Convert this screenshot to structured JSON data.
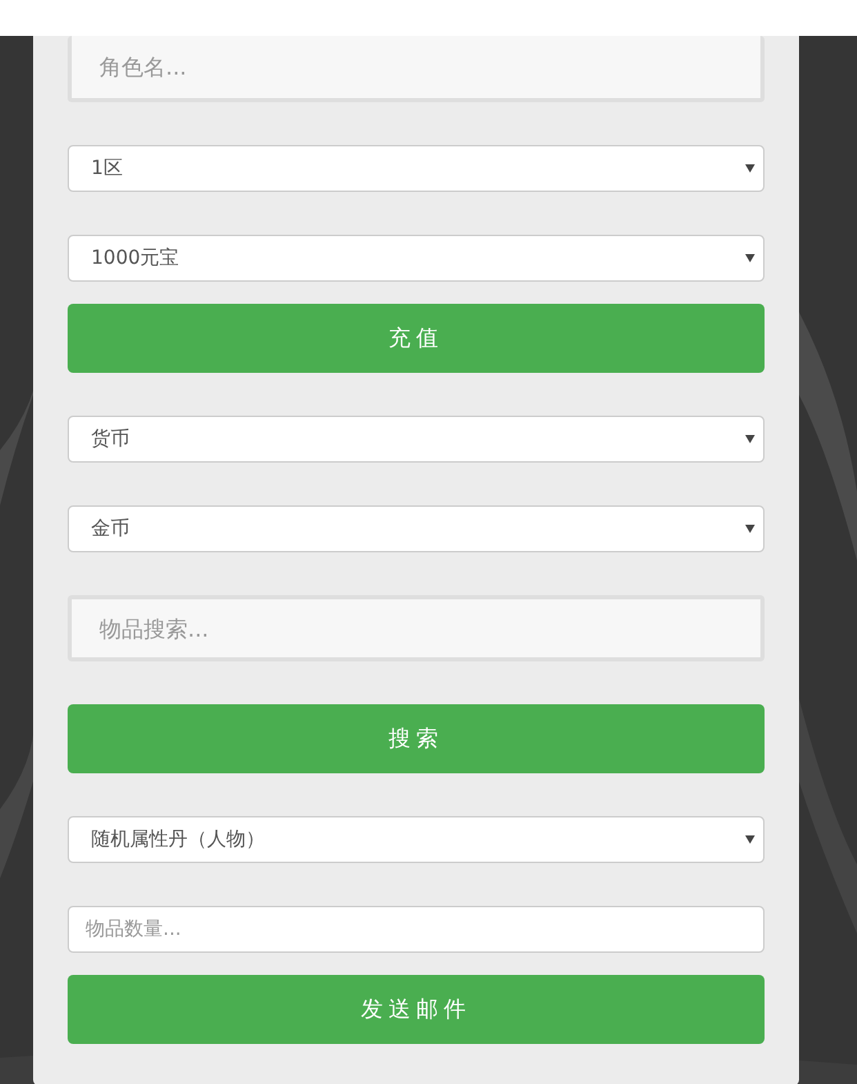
{
  "form": [
    {
      "kind": "search_field",
      "placeholder": "角色名..."
    },
    {
      "kind": "dropdown",
      "value": "1区"
    },
    {
      "kind": "dropdown",
      "value": "1000元宝"
    },
    {
      "kind": "button",
      "label": "充值"
    },
    {
      "kind": "dropdown",
      "value": "货币"
    },
    {
      "kind": "dropdown",
      "value": "金币"
    },
    {
      "kind": "search_field",
      "placeholder": "物品搜索..."
    },
    {
      "kind": "button",
      "label": "搜索"
    },
    {
      "kind": "dropdown",
      "value": "随机属性丹（人物）"
    },
    {
      "kind": "input",
      "placeholder": "物品数量..."
    },
    {
      "kind": "button",
      "label": "发送邮件"
    }
  ]
}
